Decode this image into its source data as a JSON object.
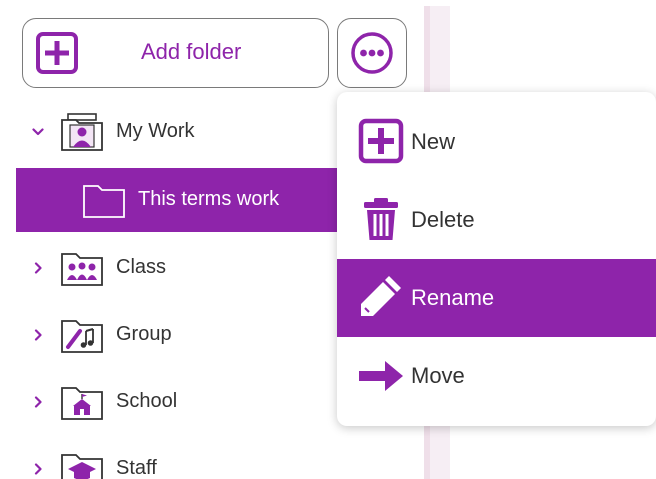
{
  "toolbar": {
    "add_folder_label": "Add folder"
  },
  "tree": {
    "items": [
      {
        "label": "My Work",
        "expanded": true,
        "icon": "my-work-icon"
      },
      {
        "label": "This terms work",
        "selected": true,
        "icon": "folder-icon"
      },
      {
        "label": "Class",
        "expanded": false,
        "icon": "class-icon"
      },
      {
        "label": "Group",
        "expanded": false,
        "icon": "group-icon"
      },
      {
        "label": "School",
        "expanded": false,
        "icon": "school-icon"
      },
      {
        "label": "Staff",
        "expanded": false,
        "icon": "staff-icon"
      }
    ]
  },
  "menu": {
    "items": [
      {
        "label": "New",
        "icon": "plus-square-icon"
      },
      {
        "label": "Delete",
        "icon": "trash-icon"
      },
      {
        "label": "Rename",
        "icon": "pencil-icon",
        "active": true
      },
      {
        "label": "Move",
        "icon": "arrow-right-icon"
      }
    ]
  },
  "colors": {
    "accent": "#8e24aa",
    "text": "#333333",
    "border": "#7a7a7a"
  }
}
